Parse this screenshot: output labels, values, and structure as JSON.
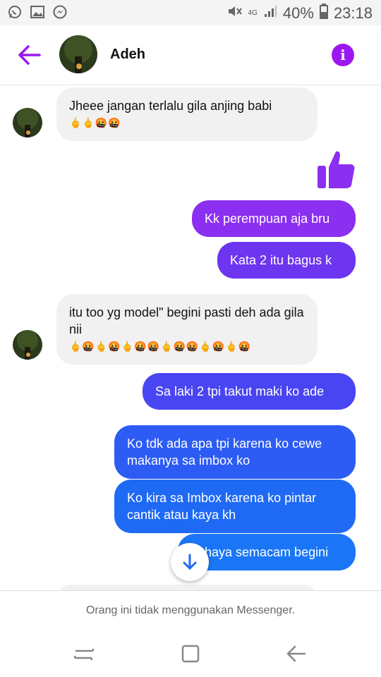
{
  "status_bar": {
    "network": "4G",
    "battery": "40%",
    "time": "23:18"
  },
  "header": {
    "contact_name": "Adeh"
  },
  "messages": [
    {
      "id": "m1",
      "dir": "in",
      "text": "Jheee jangan terlalu gila anjing babi",
      "emoji": "🖕🖕🤬🤬"
    },
    {
      "id": "m2",
      "dir": "out",
      "text": "Kk perempuan aja bru"
    },
    {
      "id": "m3",
      "dir": "out",
      "text": "Kata 2 itu bagus k"
    },
    {
      "id": "m4",
      "dir": "in",
      "text": "itu too yg model\" begini pasti deh ada gila nii",
      "emoji": "🖕🤬🖕🤬🖕🤬🤬🖕🤬🤬🖕🤬🖕🤬"
    },
    {
      "id": "m5",
      "dir": "out",
      "text": "Sa laki 2 tpi takut maki ko ade"
    },
    {
      "id": "m6",
      "dir": "out",
      "text": "Ko tdk ada apa tpi karena ko cewe makanya sa imbox ko"
    },
    {
      "id": "m7",
      "dir": "out",
      "text": "Ko kira sa Imbox karena ko pintar cantik atau kaya kh"
    },
    {
      "id": "m8",
      "dir": "out",
      "text": "haya semacam begini"
    }
  ],
  "footer": {
    "notice": "Orang ini tidak menggunakan Messenger."
  },
  "colors": {
    "accent": "#9c18f0",
    "bubble_violet": "#8b2ff0",
    "bubble_indigo": "#5c3cf0",
    "bubble_blue": "#1f6af5"
  }
}
